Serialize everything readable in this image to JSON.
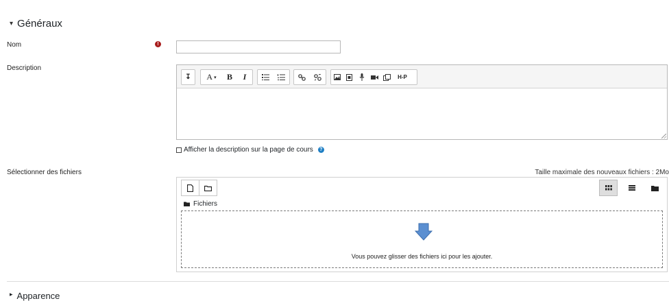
{
  "sections": {
    "general": {
      "caret": "▾",
      "title": "Généraux"
    },
    "appearance": {
      "caret": "▸",
      "title": "Apparence"
    }
  },
  "fields": {
    "nom": {
      "label": "Nom",
      "required_icon": "!",
      "value": "",
      "placeholder": ""
    },
    "description": {
      "label": "Description"
    },
    "show_description": {
      "label": "Afficher la description sur la page de cours",
      "checked": false,
      "help_icon": "?"
    },
    "files": {
      "label": "Sélectionner des fichiers",
      "max_size_text": "Taille maximale des nouveaux fichiers : 2Mo"
    }
  },
  "editor_toolbar": {
    "collapse": "↧",
    "font": "A",
    "font_dropdown": "▾",
    "bold": "B",
    "italic": "I",
    "h5p": "H-P",
    "icons": [
      "collapse-icon",
      "font-icon",
      "bold-icon",
      "italic-icon",
      "unordered-list-icon",
      "ordered-list-icon",
      "link-icon",
      "unlink-icon",
      "image-icon",
      "media-icon",
      "record-audio-icon",
      "record-video-icon",
      "manage-files-icon",
      "h5p-icon"
    ]
  },
  "file_picker": {
    "path_label": "Fichiers",
    "drop_message": "Vous pouvez glisser des fichiers ici pour les ajouter.",
    "view_active": "icons",
    "icons": [
      "add-file-icon",
      "create-folder-icon",
      "view-icons-icon",
      "view-list-icon",
      "view-tree-icon",
      "folder-icon",
      "drop-arrow-icon"
    ]
  },
  "colors": {
    "required": "#a81d1d",
    "help": "#1f7fc4",
    "arrow": "#5b8fd1"
  }
}
